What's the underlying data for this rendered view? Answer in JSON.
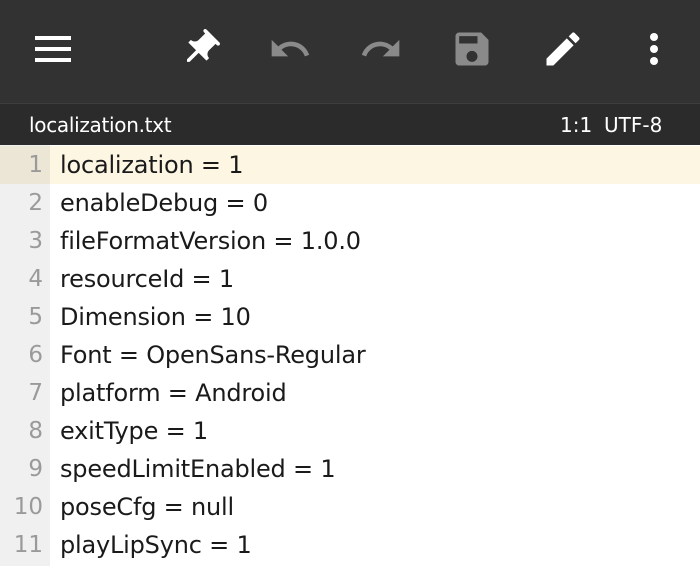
{
  "toolbar": {
    "icons": [
      "menu-icon",
      "pin-icon",
      "undo-icon",
      "redo-icon",
      "save-icon",
      "edit-icon",
      "more-vert-icon"
    ],
    "colors": {
      "background": "#323232",
      "active_icon": "#ffffff",
      "disabled_icon": "#8a8a8a"
    }
  },
  "filebar": {
    "filename": "localization.txt",
    "cursor_position": "1:1",
    "encoding": "UTF-8"
  },
  "editor": {
    "current_line": 1,
    "lines": [
      {
        "number": "1",
        "text": "localization = 1"
      },
      {
        "number": "2",
        "text": "enableDebug = 0"
      },
      {
        "number": "3",
        "text": "fileFormatVersion = 1.0.0"
      },
      {
        "number": "4",
        "text": "resourceId = 1"
      },
      {
        "number": "5",
        "text": "Dimension = 10"
      },
      {
        "number": "6",
        "text": "Font = OpenSans-Regular"
      },
      {
        "number": "7",
        "text": "platform = Android"
      },
      {
        "number": "8",
        "text": "exitType = 1"
      },
      {
        "number": "9",
        "text": "speedLimitEnabled = 1"
      },
      {
        "number": "10",
        "text": "poseCfg = null"
      },
      {
        "number": "11",
        "text": "playLipSync = 1"
      }
    ]
  }
}
